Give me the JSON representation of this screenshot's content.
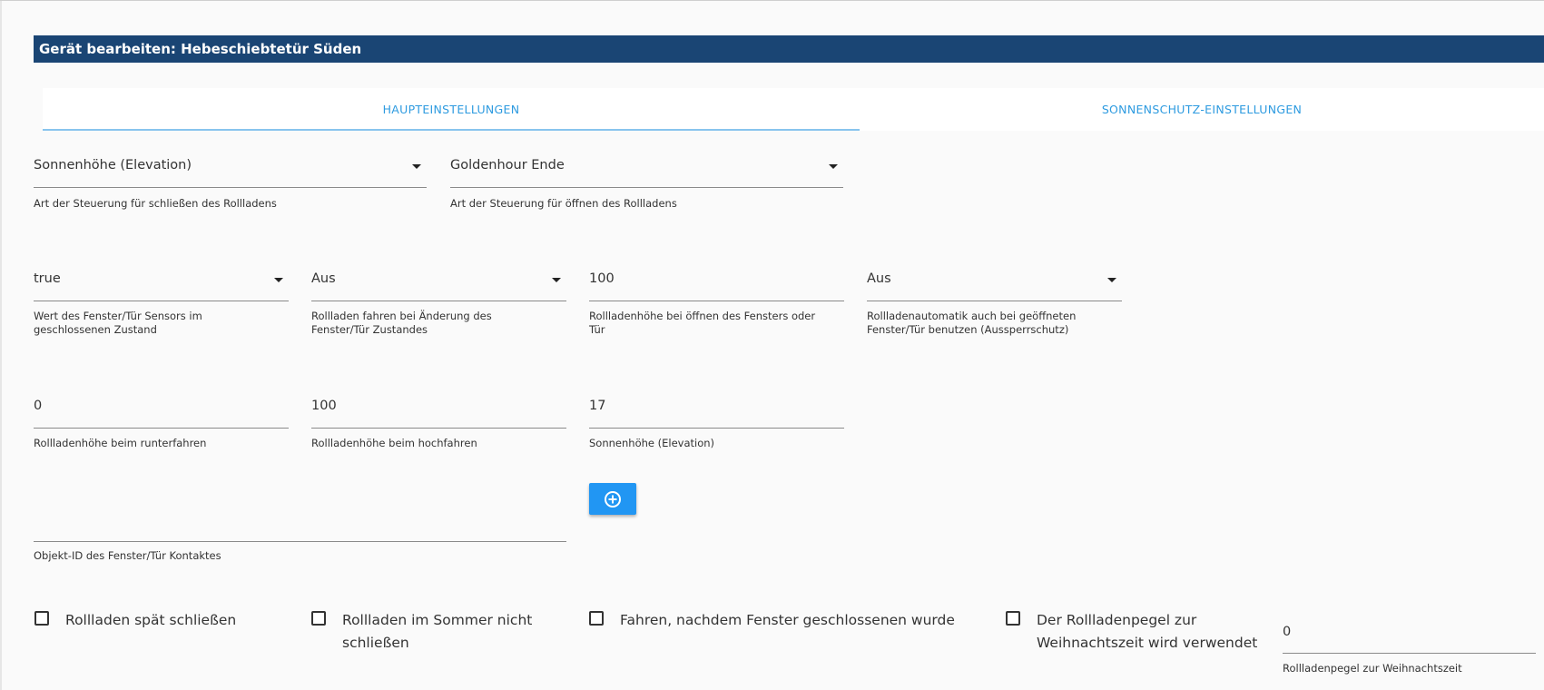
{
  "dialog": {
    "title": "Gerät bearbeiten: Hebeschiebtetür Süden"
  },
  "tabs": [
    {
      "label": "HAUPTEINSTELLUNGEN",
      "active": true
    },
    {
      "label": "SONNENSCHUTZ-EINSTELLUNGEN",
      "active": false
    }
  ],
  "row1": {
    "close_type": {
      "value": "Sonnenhöhe (Elevation)",
      "helper": "Art der Steuerung für schließen des Rollladens"
    },
    "open_type": {
      "value": "Goldenhour Ende",
      "helper": "Art der Steuerung für öffnen des Rollladens"
    }
  },
  "row2": {
    "sensor_value": {
      "value": "true",
      "helper": "Wert des Fenster/Tür Sensors im geschlossenen Zustand"
    },
    "move_on_change": {
      "value": "Aus",
      "helper": "Rollladen fahren bei Änderung des Fenster/Tür Zustandes"
    },
    "open_height": {
      "value": "100",
      "helper": "Rollladenhöhe bei öffnen des Fensters oder Tür"
    },
    "lockout": {
      "value": "Aus",
      "helper": "Rollladenautomatik auch bei geöffneten Fenster/Tür benutzen (Aussperrschutz)"
    }
  },
  "row3": {
    "down_height": {
      "value": "0",
      "helper": "Rollladenhöhe beim runterfahren"
    },
    "up_height": {
      "value": "100",
      "helper": "Rollladenhöhe beim hochfahren"
    },
    "elevation": {
      "value": "17",
      "helper": "Sonnenhöhe (Elevation)"
    }
  },
  "contact": {
    "value": "",
    "helper": "Objekt-ID des Fenster/Tür Kontaktes"
  },
  "checkboxes": [
    {
      "label_line1": "Rollladen spät schließen",
      "label_line2": "",
      "checked": false
    },
    {
      "label_line1": "Rollladen im Sommer nicht",
      "label_line2": "schließen",
      "checked": false
    },
    {
      "label_line1": "Fahren, nachdem Fenster geschlossenen wurde",
      "label_line2": "",
      "checked": false
    },
    {
      "label_line1": "Der Rollladenpegel zur",
      "label_line2": "Weihnachtszeit wird verwendet",
      "checked": false
    }
  ],
  "christmas_level": {
    "value": "0",
    "helper": "Rollladenpegel zur Weihnachtszeit"
  },
  "colors": {
    "title_bar": "#1a4574",
    "accent": "#2e9be0",
    "button": "#2196f3"
  },
  "icons": {
    "add": "plus-circle-icon",
    "dropdown": "triangle-down-icon"
  }
}
